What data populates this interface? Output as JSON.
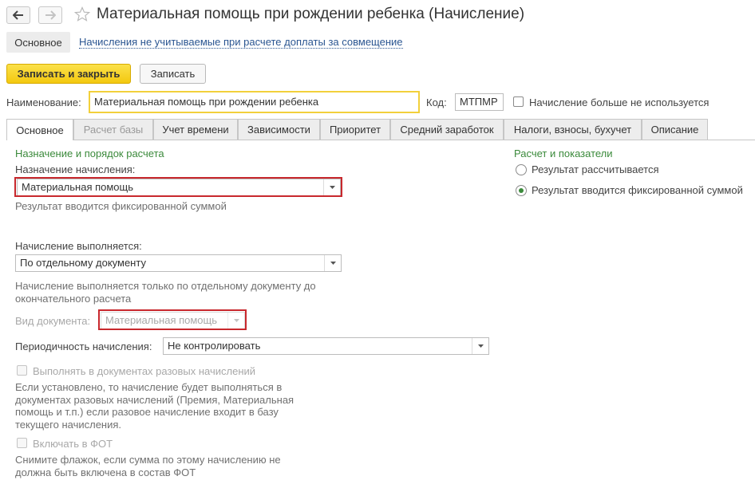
{
  "window": {
    "title": "Материальная помощь при рождении ребенка (Начисление)"
  },
  "top_nav": {
    "active": "Основное",
    "link": "Начисления не учитываемые при расчете доплаты за совмещение"
  },
  "toolbar": {
    "save_close_label": "Записать и закрыть",
    "save_label": "Записать"
  },
  "header_fields": {
    "name_label": "Наименование:",
    "name_value": "Материальная помощь при рождении ребенка",
    "code_label": "Код:",
    "code_value": "МТПМР",
    "unused_label": "Начисление больше не используется"
  },
  "tabs": [
    {
      "label": "Основное"
    },
    {
      "label": "Расчет базы"
    },
    {
      "label": "Учет времени"
    },
    {
      "label": "Зависимости"
    },
    {
      "label": "Приоритет"
    },
    {
      "label": "Средний заработок"
    },
    {
      "label": "Налоги, взносы, бухучет"
    },
    {
      "label": "Описание"
    }
  ],
  "left": {
    "section_title": "Назначение и порядок расчета",
    "purpose_label": "Назначение начисления:",
    "purpose_value": "Материальная помощь",
    "purpose_hint": "Результат вводится фиксированной суммой",
    "exec_label": "Начисление выполняется:",
    "exec_value": "По отдельному документу",
    "exec_hint": "Начисление выполняется только по отдельному документу до окончательного расчета",
    "doc_type_label": "Вид документа:",
    "doc_type_value": "Материальная помощь",
    "period_label": "Периодичность начисления:",
    "period_value": "Не контролировать",
    "oneoff_label": "Выполнять в документах разовых начислений",
    "oneoff_hint": "Если установлено, то начисление будет выполняться в документах разовых начислений (Премия, Материальная помощь и т.п.) если разовое начисление входит в базу текущего начисления.",
    "fot_label": "Включать в ФОТ",
    "fot_hint": "Снимите флажок, если сумма по этому начислению не должна быть включена в состав ФОТ"
  },
  "right": {
    "section_title": "Расчет и показатели",
    "options": [
      {
        "label": "Результат рассчитывается",
        "selected": false
      },
      {
        "label": "Результат вводится фиксированной суммой",
        "selected": true
      }
    ]
  },
  "colors": {
    "accent_yellow": "#f3c80f",
    "section_green": "#3b8a3b",
    "highlight_red": "#c8282d",
    "link_blue": "#2a5591"
  }
}
